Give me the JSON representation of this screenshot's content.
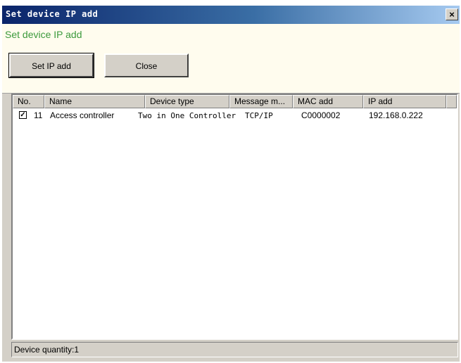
{
  "window": {
    "title": "Set device IP add",
    "close_glyph": "×",
    "close_icon": "close-icon"
  },
  "header": {
    "subtitle": "Set device IP add",
    "subtitle_color": "#3c9a3c"
  },
  "toolbar": {
    "set_ip_label": "Set IP add",
    "close_label": "Close"
  },
  "table": {
    "columns": [
      "No.",
      "Name",
      "Device type",
      "Message m...",
      "MAC add",
      "IP add"
    ],
    "rows": [
      {
        "checked": true,
        "check_glyph": "✓",
        "no": "11",
        "name": "Access controller",
        "device_type": "Two in One Controller",
        "message_mode": "TCP/IP",
        "mac": "C0000002",
        "ip": "192.168.0.222"
      }
    ]
  },
  "status": {
    "text": "Device quantity:1"
  }
}
